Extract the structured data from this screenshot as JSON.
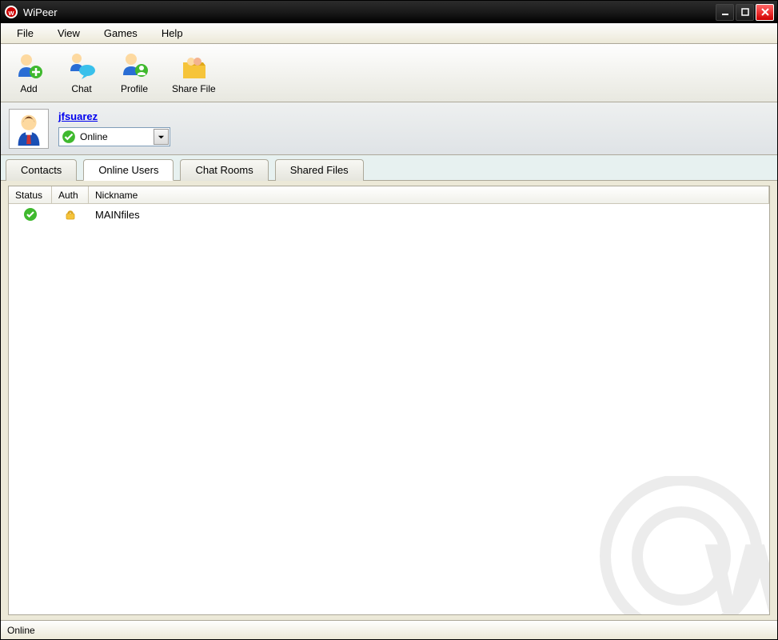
{
  "window": {
    "title": "WiPeer"
  },
  "menu": {
    "file": "File",
    "view": "View",
    "games": "Games",
    "help": "Help"
  },
  "toolbar": {
    "add": "Add",
    "chat": "Chat",
    "profile": "Profile",
    "share": "Share File"
  },
  "user": {
    "name": "jfsuarez",
    "status": "Online"
  },
  "tabs": {
    "contacts": "Contacts",
    "online": "Online Users",
    "rooms": "Chat Rooms",
    "shared": "Shared Files"
  },
  "columns": {
    "status": "Status",
    "auth": "Auth",
    "nickname": "Nickname"
  },
  "rows": [
    {
      "nickname": "MAINfiles"
    }
  ],
  "statusbar": {
    "text": "Online"
  }
}
